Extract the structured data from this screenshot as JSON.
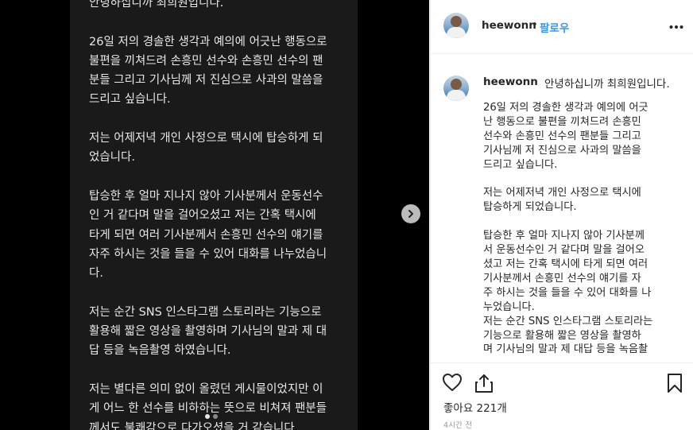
{
  "post": {
    "media_lines": "안녕하십니까 최희원입니다.\n\n26일 저의 경솔한 생각과 예의에 어긋난 행동으로\n불편을 끼쳐드려 손흥민 선수와 손흥민 선수의 팬\n분들 그리고 기사님께 저 진심으로 사과의 말씀을\n드리고 싶습니다.\n\n저는 어제저녁 개인 사정으로 택시에 탑승하게 되\n었습니다.\n\n탑승한 후 얼마 지나지 않아 기사분께서 운동선수\n인 거 같다며 말을 걸어오셨고 저는 간혹 택시에\n타게 되면 여러 기사분께서 손흥민 선수의 얘기를\n자주 하시는 것을 들을 수 있어 대화를 나누었습니\n다.\n\n저는 순간 SNS 인스타그램 스토리라는 기능으로\n활용해 짧은 영상을 촬영하며 기사님의 말과 제 대\n답 등을 녹음촬영 하였습니다.\n\n저는 별다른 의미 없이 올렸던 게시물이었지만 이\n게 어느 한 선수를 비하하는 뜻으로 비쳐져 팬분들\n께서도 불쾌감으로 다가오셨을 거 같습니다."
  },
  "header": {
    "username": "heewonn",
    "separator": "•",
    "follow_label": "팔로우",
    "more_label": "•••"
  },
  "caption": {
    "username": "heewonn",
    "first_line": "안녕하십니까 최희원입니다.",
    "body": "26일 저의 경솔한 생각과 예의에 어긋\n난 행동으로 불편을 끼쳐드려 손흥민\n선수와 손흥민 선수의 팬분들 그리고\n기사님께 저 진심으로 사과의 말씀을\n드리고 싶습니다.\n\n저는 어제저녁 개인 사정으로 택시에\n탑승하게 되었습니다.\n\n탑승한 후 얼마 지나지 않아 기사분께\n서 운동선수인 거 같다며 말을 걸어오\n셨고 저는 간혹 택시에 타게 되면 여러\n기사분께서 손흥민 선수의 얘기를 자\n주 하시는 것을 들을 수 있어 대화를 나\n누었습니다.\n저는 순간 SNS 인스타그램 스토리라는\n기능으로 활용해 짧은 영상을 촬영하\n며 기사님의 말과 제 대답 등을 녹음촬"
  },
  "actions": {
    "likes_label": "좋아요 221개",
    "time_label": "4시간 전"
  },
  "icons": {
    "like": "heart-icon",
    "share": "share-icon",
    "save": "bookmark-icon",
    "next": "chevron-right-icon",
    "more": "more-icon"
  },
  "colors": {
    "follow": "#3897f0",
    "text": "#262626",
    "muted": "#999999",
    "media_bg": "#1a1a1a"
  }
}
